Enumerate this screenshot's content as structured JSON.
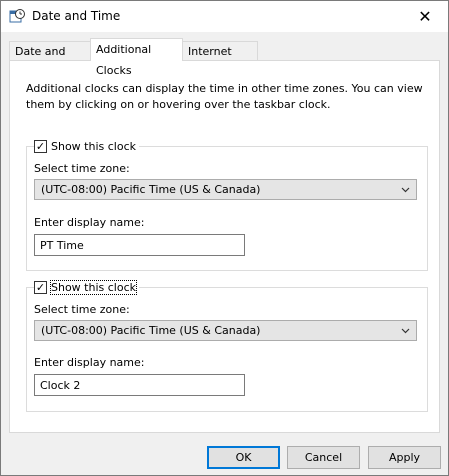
{
  "window": {
    "title": "Date and Time"
  },
  "tabs": [
    {
      "label": "Date and Time",
      "active": false
    },
    {
      "label": "Additional Clocks",
      "active": true
    },
    {
      "label": "Internet Time",
      "active": false
    }
  ],
  "description": "Additional clocks can display the time in other time zones. You can view them by clicking on or hovering over the taskbar clock.",
  "clocks": [
    {
      "show_label": "Show this clock",
      "checked": true,
      "timezone_label": "Select time zone:",
      "timezone_value": "(UTC-08:00) Pacific Time (US & Canada)",
      "display_name_label": "Enter display name:",
      "display_name_value": "PT Time"
    },
    {
      "show_label": "Show this clock",
      "checked": true,
      "timezone_label": "Select time zone:",
      "timezone_value": "(UTC-08:00) Pacific Time (US & Canada)",
      "display_name_label": "Enter display name:",
      "display_name_value": "Clock 2"
    }
  ],
  "buttons": {
    "ok": "OK",
    "cancel": "Cancel",
    "apply": "Apply"
  },
  "colors": {
    "accent": "#0078d7",
    "panel": "#ffffff",
    "window_bg": "#f0f0f0"
  },
  "icons": {
    "app": "clock-calendar-icon",
    "close": "close-icon",
    "dropdown": "chevron-down-icon",
    "check": "checkmark-icon"
  }
}
